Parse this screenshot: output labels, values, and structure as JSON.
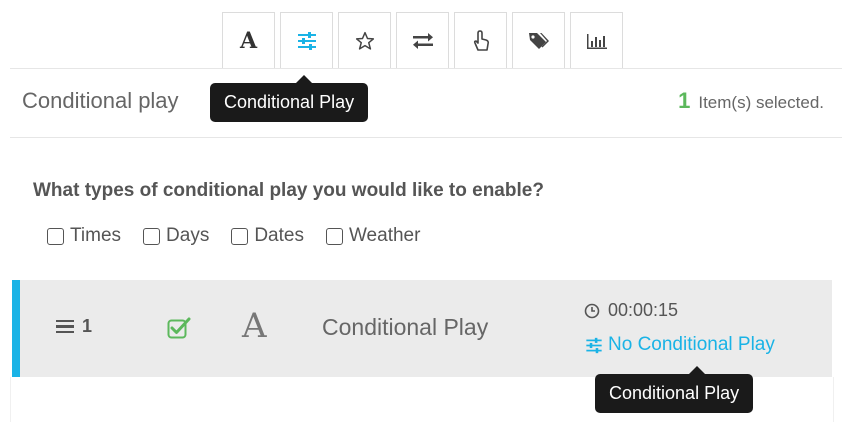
{
  "toolbar": {
    "buttons": [
      {
        "icon": "text-icon",
        "glyph": "A"
      },
      {
        "icon": "sliders-icon",
        "active": true
      },
      {
        "icon": "star-icon"
      },
      {
        "icon": "transition-arrows-icon"
      },
      {
        "icon": "pointer-hand-icon"
      },
      {
        "icon": "tags-icon"
      },
      {
        "icon": "bar-chart-icon"
      }
    ],
    "tooltip": "Conditional Play"
  },
  "header": {
    "title": "Conditional play",
    "selected_count": "1",
    "selected_label": "Item(s) selected."
  },
  "question": {
    "label": "What types of conditional play you would like to enable?",
    "options": [
      "Times",
      "Days",
      "Dates",
      "Weather"
    ]
  },
  "item": {
    "index": "1",
    "type_glyph": "A",
    "name": "Conditional Play",
    "duration": "00:00:15",
    "conditional_link": "No Conditional Play",
    "tooltip": "Conditional Play"
  },
  "colors": {
    "accent": "#1ab3e6",
    "success": "#5cb85c",
    "tooltip_bg": "#1a1a1a"
  }
}
